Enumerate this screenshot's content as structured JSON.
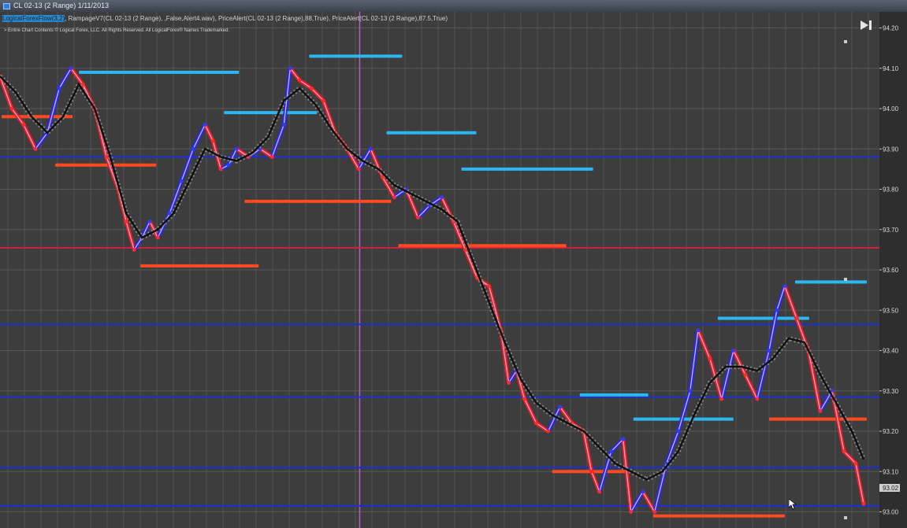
{
  "window": {
    "title": "CL 02-13 (2 Range)  1/11/2013"
  },
  "overlay": {
    "indicator_prefix": "LogicalForexFlow(3,2)",
    "indicator_rest": ", RampageV7(CL 02-13 (2 Range), ,False,Alert4.wav), PriceAlert(CL 02-13 (2 Range),88,True), PriceAlert(CL 02-13 (2 Range),87.5,True)",
    "copyright": "> Entire Chart Contents © Logical Forex, LLC. All Rights Reserved. All LogicalForex® Names Trademarked.",
    "skip_to_end_icon": "skip-to-end-icon"
  },
  "chart_data": {
    "type": "line",
    "instrument": "CL 02-13 (2 Range)",
    "date": "1/11/2013",
    "y_axis": {
      "ticks": [
        "94.20",
        "94.10",
        "94.00",
        "93.90",
        "93.80",
        "93.70",
        "93.60",
        "93.50",
        "93.40",
        "93.30",
        "93.20",
        "93.10",
        "93.00"
      ],
      "range": [
        92.96,
        94.24
      ]
    },
    "x_range": [
      0,
      1115
    ],
    "last_price_label": "93.02",
    "series": [
      {
        "role": "price",
        "color": "#f0b0f0",
        "x": [
          0,
          15,
          30,
          45,
          60,
          75,
          90,
          105,
          120,
          135,
          150,
          160,
          170,
          180,
          190,
          200,
          215,
          230,
          245,
          260,
          270,
          280,
          290,
          300,
          315,
          330,
          345,
          360,
          368,
          380,
          395,
          410,
          425,
          440,
          455,
          470,
          485,
          500,
          515,
          530,
          545,
          560,
          575,
          590,
          605,
          620,
          635,
          645,
          655,
          665,
          680,
          695,
          710,
          725,
          740,
          750,
          760,
          775,
          790,
          800,
          815,
          830,
          845,
          860,
          875,
          885,
          900,
          915,
          930,
          945,
          960,
          975,
          985,
          995,
          1010,
          1025,
          1040,
          1055,
          1070,
          1085,
          1095
        ],
        "y": [
          94.08,
          94.0,
          93.96,
          93.9,
          93.94,
          94.05,
          94.1,
          94.06,
          94.0,
          93.88,
          93.8,
          93.72,
          93.65,
          93.68,
          93.72,
          93.68,
          93.74,
          93.82,
          93.9,
          93.96,
          93.92,
          93.85,
          93.86,
          93.9,
          93.88,
          93.9,
          93.88,
          93.96,
          94.1,
          94.07,
          94.05,
          94.02,
          93.94,
          93.9,
          93.85,
          93.9,
          93.83,
          93.78,
          93.8,
          93.73,
          93.76,
          93.78,
          93.72,
          93.65,
          93.58,
          93.56,
          93.45,
          93.32,
          93.35,
          93.28,
          93.22,
          93.2,
          93.26,
          93.22,
          93.2,
          93.1,
          93.05,
          93.15,
          93.18,
          93.0,
          93.05,
          93.0,
          93.12,
          93.2,
          93.3,
          93.45,
          93.38,
          93.28,
          93.4,
          93.34,
          93.28,
          93.4,
          93.5,
          93.56,
          93.48,
          93.4,
          93.25,
          93.3,
          93.15,
          93.12,
          93.02
        ]
      },
      {
        "role": "smoothed",
        "color": "#111111",
        "x": [
          0,
          20,
          40,
          60,
          80,
          100,
          120,
          140,
          160,
          180,
          200,
          220,
          240,
          260,
          280,
          300,
          320,
          340,
          360,
          380,
          400,
          420,
          440,
          460,
          480,
          500,
          520,
          540,
          560,
          580,
          600,
          620,
          640,
          660,
          680,
          700,
          720,
          740,
          760,
          780,
          800,
          820,
          840,
          860,
          880,
          900,
          920,
          940,
          960,
          980,
          1000,
          1020,
          1040,
          1060,
          1080,
          1095
        ],
        "y": [
          94.08,
          94.04,
          93.98,
          93.94,
          93.98,
          94.06,
          94.0,
          93.88,
          93.74,
          93.68,
          93.7,
          93.74,
          93.82,
          93.9,
          93.88,
          93.87,
          93.89,
          93.93,
          94.02,
          94.05,
          94.01,
          93.95,
          93.9,
          93.87,
          93.85,
          93.81,
          93.79,
          93.77,
          93.75,
          93.72,
          93.62,
          93.52,
          93.42,
          93.33,
          93.27,
          93.24,
          93.22,
          93.2,
          93.16,
          93.12,
          93.1,
          93.08,
          93.1,
          93.15,
          93.24,
          93.32,
          93.36,
          93.36,
          93.35,
          93.38,
          93.43,
          93.42,
          93.34,
          93.27,
          93.2,
          93.13
        ]
      }
    ],
    "horizontal_lines": [
      {
        "price": 93.88,
        "color": "#1a2fd8"
      },
      {
        "price": 93.655,
        "color": "#d02040"
      },
      {
        "price": 93.465,
        "color": "#1a2fd8"
      },
      {
        "price": 93.285,
        "color": "#1a2fd8"
      },
      {
        "price": 93.11,
        "color": "#1a2fd8"
      },
      {
        "price": 93.015,
        "color": "#1a2fd8"
      }
    ],
    "level_bars": [
      {
        "price": 94.09,
        "x0": 100,
        "x1": 303,
        "color": "#2bb8f0"
      },
      {
        "price": 94.13,
        "x0": 392,
        "x1": 510,
        "color": "#2bb8f0"
      },
      {
        "price": 93.99,
        "x0": 284,
        "x1": 402,
        "color": "#2bb8f0"
      },
      {
        "price": 93.94,
        "x0": 490,
        "x1": 604,
        "color": "#2bb8f0"
      },
      {
        "price": 93.85,
        "x0": 585,
        "x1": 752,
        "color": "#2bb8f0"
      },
      {
        "price": 93.86,
        "x0": 70,
        "x1": 198,
        "color": "#ff4a20"
      },
      {
        "price": 93.77,
        "x0": 310,
        "x1": 496,
        "color": "#ff4a20"
      },
      {
        "price": 93.66,
        "x0": 505,
        "x1": 718,
        "color": "#ff4a20"
      },
      {
        "price": 93.61,
        "x0": 178,
        "x1": 328,
        "color": "#ff4a20"
      },
      {
        "price": 93.98,
        "x0": 2,
        "x1": 92,
        "color": "#ff4a20"
      },
      {
        "price": 93.57,
        "x0": 1008,
        "x1": 1099,
        "color": "#2bb8f0"
      },
      {
        "price": 93.48,
        "x0": 910,
        "x1": 1026,
        "color": "#2bb8f0"
      },
      {
        "price": 93.29,
        "x0": 735,
        "x1": 822,
        "color": "#2bb8f0"
      },
      {
        "price": 93.23,
        "x0": 803,
        "x1": 930,
        "color": "#2bb8f0"
      },
      {
        "price": 93.23,
        "x0": 975,
        "x1": 1099,
        "color": "#ff4a20"
      },
      {
        "price": 93.1,
        "x0": 700,
        "x1": 800,
        "color": "#ff4a20"
      },
      {
        "price": 92.99,
        "x0": 828,
        "x1": 995,
        "color": "#ff4a20"
      }
    ],
    "purple_vertical_x": 456,
    "grid": true,
    "legend": "none"
  }
}
